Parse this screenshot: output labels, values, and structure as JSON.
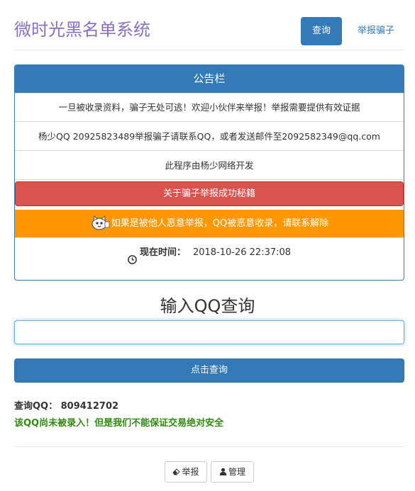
{
  "header": {
    "site_title": "微时光黑名单系统",
    "nav": {
      "query_label": "查询",
      "report_label": "举报骗子"
    }
  },
  "announcement": {
    "title": "公告栏",
    "line1": "一旦被收录资料，骗子无处可逃！欢迎小伙伴来举报！举报需要提供有效证据",
    "line2": "杨少QQ 20925823489举报骗子请联系QQ，或者发送邮件至2092582349@qq.com",
    "line3": "此程序由杨少网络开发",
    "red_button_label": "关于骗子举报成功秘籍",
    "orange_notice": "如果是被他人恶意举报，QQ被恶意收录，请联系解除",
    "time_label": "现在时间：",
    "time_value": "2018-10-26 22:37:08"
  },
  "query": {
    "heading": "输入QQ查询",
    "input_value": "",
    "submit_label": "点击查询"
  },
  "result": {
    "qq_line": "查询QQ：  809412702",
    "status": "该QQ尚未被录入！但是我们不能保证交易绝对安全"
  },
  "footer": {
    "report_label": "举报",
    "admin_label": "管理"
  },
  "colors": {
    "primary": "#337ab7",
    "danger": "#d9534f",
    "warning": "#ff9800",
    "success_text": "#2e8b0e",
    "title_purple": "#8a6fc0"
  }
}
